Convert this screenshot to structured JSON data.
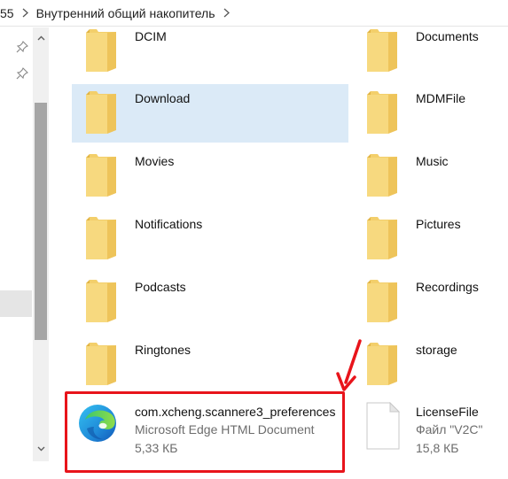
{
  "breadcrumb": {
    "prev_fragment": "55",
    "current": "Внутренний общий накопитель"
  },
  "folders_left": [
    {
      "name": "DCIM"
    },
    {
      "name": "Download",
      "selected": true
    },
    {
      "name": "Movies"
    },
    {
      "name": "Notifications"
    },
    {
      "name": "Podcasts"
    },
    {
      "name": "Ringtones"
    }
  ],
  "folders_right": [
    {
      "name": "Documents"
    },
    {
      "name": "MDMFile"
    },
    {
      "name": "Music"
    },
    {
      "name": "Pictures"
    },
    {
      "name": "Recordings"
    },
    {
      "name": "storage"
    }
  ],
  "files": {
    "edge_doc": {
      "name": "com.xcheng.scannere3_preferences",
      "type": "Microsoft Edge HTML Document",
      "size": "5,33 КБ",
      "icon": "microsoft-edge-icon"
    },
    "license": {
      "name": "LicenseFile",
      "type": "Файл \"V2C\"",
      "size": "15,8 КБ",
      "icon": "blank-file-icon"
    }
  },
  "colors": {
    "folder": "#f3cf6b",
    "selection": "#dbeaf7",
    "highlight": "#e8141b",
    "scroll_thumb": "#a6a6a6"
  }
}
